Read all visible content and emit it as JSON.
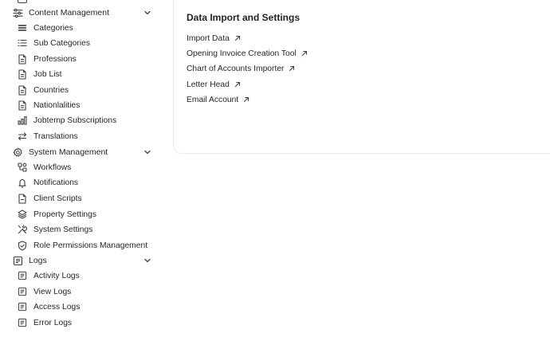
{
  "sidebar": {
    "groups": [
      {
        "label": "Content Management",
        "icon": "sliders-icon",
        "items": [
          {
            "label": "Categories",
            "icon": "menu-lines-icon"
          },
          {
            "label": "Sub Categories",
            "icon": "list-icon"
          },
          {
            "label": "Professions",
            "icon": "file-text-icon"
          },
          {
            "label": "Job List",
            "icon": "file-text-icon"
          },
          {
            "label": "Countries",
            "icon": "file-text-icon"
          },
          {
            "label": "Nationlalities",
            "icon": "file-text-icon"
          },
          {
            "label": "Jobtemp Subscriptions",
            "icon": "bar-chart-icon"
          },
          {
            "label": "Translations",
            "icon": "swap-arrows-icon"
          }
        ]
      },
      {
        "label": "System Management",
        "icon": "gear-icon",
        "items": [
          {
            "label": "Workflows",
            "icon": "workflow-icon"
          },
          {
            "label": "Notifications",
            "icon": "bell-icon"
          },
          {
            "label": "Client Scripts",
            "icon": "file-icon"
          },
          {
            "label": "Property Settings",
            "icon": "layers-icon"
          },
          {
            "label": "System Settings",
            "icon": "tools-icon"
          },
          {
            "label": "Role Permissions Management",
            "icon": "shield-icon"
          }
        ]
      },
      {
        "label": "Logs",
        "icon": "log-file-icon",
        "items": [
          {
            "label": "Activity Logs",
            "icon": "log-file-icon"
          },
          {
            "label": "View Logs",
            "icon": "log-file-icon"
          },
          {
            "label": "Access Logs",
            "icon": "log-file-icon"
          },
          {
            "label": "Error Logs",
            "icon": "log-file-icon"
          }
        ]
      }
    ]
  },
  "main": {
    "card": {
      "title": "Data Import and Settings",
      "links": [
        {
          "label": "Import Data",
          "icon": "arrow-up-right-icon"
        },
        {
          "label": "Opening Invoice Creation Tool",
          "icon": "arrow-up-right-icon"
        },
        {
          "label": "Chart of Accounts Importer",
          "icon": "arrow-up-right-icon"
        },
        {
          "label": "Letter Head",
          "icon": "arrow-up-right-icon"
        },
        {
          "label": "Email Account",
          "icon": "arrow-up-right-icon"
        }
      ]
    }
  }
}
